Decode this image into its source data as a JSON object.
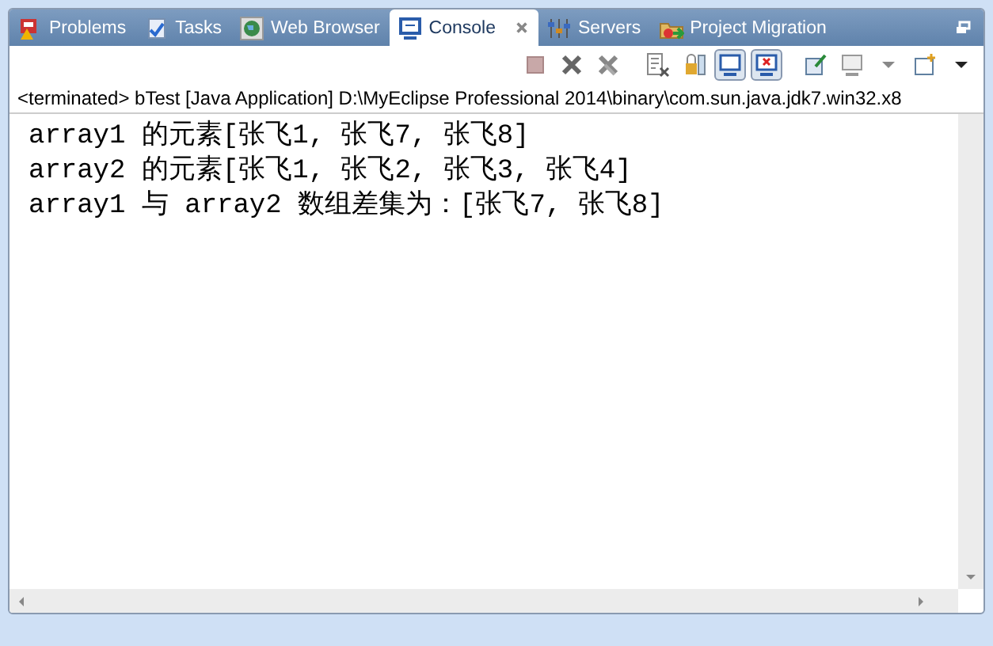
{
  "tabs": [
    {
      "label": "Problems",
      "selected": false
    },
    {
      "label": "Tasks",
      "selected": false
    },
    {
      "label": "Web Browser",
      "selected": false
    },
    {
      "label": "Console",
      "selected": true
    },
    {
      "label": "Servers",
      "selected": false
    },
    {
      "label": "Project Migration",
      "selected": false
    }
  ],
  "process_label": "<terminated> bTest [Java Application] D:\\MyEclipse Professional 2014\\binary\\com.sun.java.jdk7.win32.x8",
  "console_lines": [
    "array1 的元素[张飞1, 张飞7, 张飞8]",
    "array2 的元素[张飞1, 张飞2, 张飞3, 张飞4]",
    "array1 与 array2 数组差集为：[张飞7, 张飞8]"
  ]
}
